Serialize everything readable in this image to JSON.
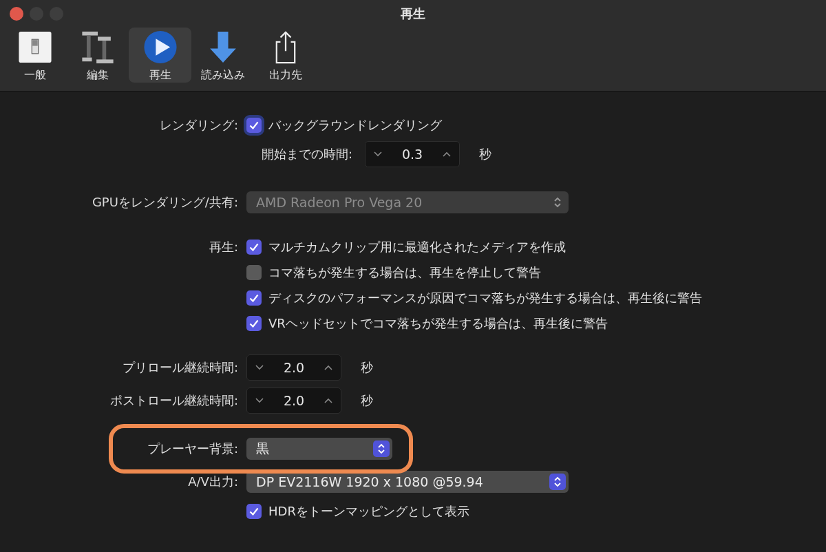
{
  "window": {
    "title": "再生"
  },
  "toolbar": [
    {
      "label": "一般",
      "kind": "general",
      "selected": false
    },
    {
      "label": "編集",
      "kind": "edit",
      "selected": false
    },
    {
      "label": "再生",
      "kind": "playback",
      "selected": true
    },
    {
      "label": "読み込み",
      "kind": "import",
      "selected": false
    },
    {
      "label": "出力先",
      "kind": "destination",
      "selected": false
    }
  ],
  "groups": [
    {
      "rows": [
        {
          "kind": "checkbox",
          "label": "レンダリング:",
          "text": "バックグラウンドレンダリング",
          "checked": true,
          "focused": true
        },
        {
          "kind": "inline-stepper",
          "label": "開始までの時間:",
          "value": "0.3",
          "unit": "秒"
        }
      ]
    },
    {
      "rows": [
        {
          "kind": "popup",
          "label": "GPUをレンダリング/共有:",
          "value": "AMD Radeon Pro Vega 20",
          "disabled": true
        }
      ]
    },
    {
      "rows": [
        {
          "kind": "checkbox",
          "label": "再生:",
          "text": "マルチカムクリップ用に最適化されたメディアを作成",
          "checked": true
        },
        {
          "kind": "checkbox",
          "text": "コマ落ちが発生する場合は、再生を停止して警告",
          "checked": false
        },
        {
          "kind": "checkbox",
          "text": "ディスクのパフォーマンスが原因でコマ落ちが発生する場合は、再生後に警告",
          "checked": true
        },
        {
          "kind": "checkbox",
          "text": "VRヘッドセットでコマ落ちが発生する場合は、再生後に警告",
          "checked": true
        }
      ]
    },
    {
      "rows": [
        {
          "kind": "stepper",
          "label": "プリロール継続時間:",
          "value": "2.0",
          "unit": "秒"
        },
        {
          "kind": "stepper",
          "label": "ポストロール継続時間:",
          "value": "2.0",
          "unit": "秒"
        }
      ]
    },
    {
      "rows": [
        {
          "kind": "short-popup",
          "label": "プレーヤー背景:",
          "value": "黒",
          "disabled": false,
          "highlighted": true
        },
        {
          "kind": "popup",
          "label": "A/V出力:",
          "value": "DP EV2116W 1920 x 1080 @59.94",
          "disabled": false
        },
        {
          "kind": "checkbox",
          "text": "HDRをトーンマッピングとして表示",
          "checked": true
        }
      ]
    }
  ]
}
